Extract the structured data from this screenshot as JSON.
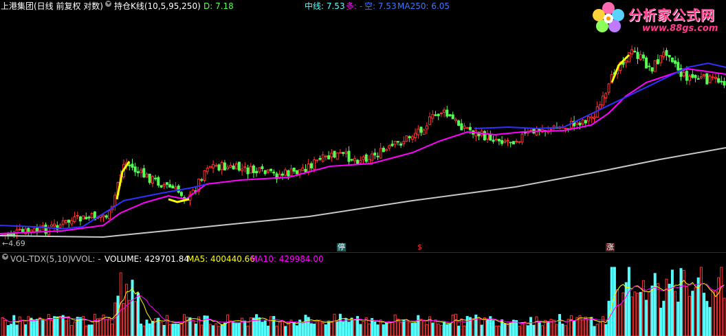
{
  "main_header": {
    "stock": "上港集团(日线 前复权 对数)",
    "indicator": "持仓K线(10,5,95,250)",
    "d_value": "D: 7.18",
    "mid_line": "中线: 7.53",
    "duo": "多: -",
    "kong": "空: 7.53",
    "ma250": "MA250: 6.05"
  },
  "vol_header": {
    "name": "VOL-TDX(5,10)",
    "vvol": "VVOL: -",
    "volume": "VOLUME: 429701.84",
    "ma5": "MA5: 400440.66",
    "ma10": "MA10: 429984.00"
  },
  "markers": {
    "low_price": "←4.69",
    "ting": "停",
    "s": "$",
    "zhang": "涨"
  },
  "logo": {
    "title": "分析家公式网",
    "url": "www.88gs.com"
  },
  "colors": {
    "background": "#000000",
    "up": "#ff3232",
    "down": "#54ff54",
    "ma_mid": "#ff00ff",
    "ma_blue": "#3030ff",
    "ma250": "#c8c8c8",
    "yellow": "#ffff00",
    "cyan": "#54ffff"
  }
}
